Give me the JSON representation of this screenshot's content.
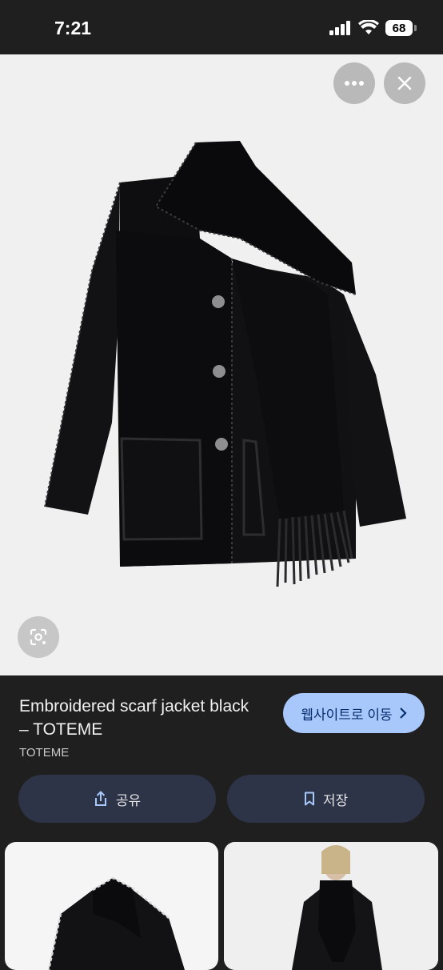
{
  "status": {
    "time": "7:21",
    "battery": "68"
  },
  "viewer": {
    "more_icon": "more-horiz-icon",
    "close_icon": "close-icon",
    "lens_icon": "lens-search-icon"
  },
  "product": {
    "title": "Embroidered scarf jacket black – TOTEME",
    "source": "TOTEME",
    "visit_label": "웹사이트로 이동",
    "share_label": "공유",
    "save_label": "저장"
  },
  "colors": {
    "visit_bg": "#a8c7fa",
    "action_bg": "#2e3447",
    "panel_bg": "#1f1f1f"
  }
}
